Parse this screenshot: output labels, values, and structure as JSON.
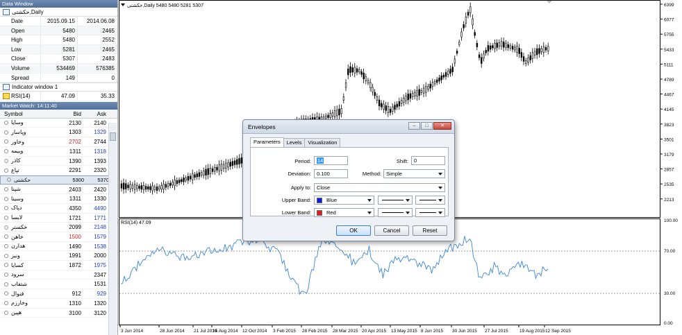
{
  "data_window": {
    "title": "Data Window",
    "symbol_row": "حکشتی,Daily",
    "rows": [
      {
        "label": "Date",
        "v1": "2015.09.15",
        "v2": "2014.06.08"
      },
      {
        "label": "Open",
        "v1": "5480",
        "v2": "2465"
      },
      {
        "label": "High",
        "v1": "5480",
        "v2": "2552"
      },
      {
        "label": "Low",
        "v1": "5281",
        "v2": "2465"
      },
      {
        "label": "Close",
        "v1": "5307",
        "v2": "2483"
      },
      {
        "label": "Volume",
        "v1": "534469",
        "v2": "576385"
      },
      {
        "label": "Spread",
        "v1": "149",
        "v2": "0"
      }
    ],
    "indicator_window": "Indicator window 1",
    "rsi_row": {
      "label": "RSI(14)",
      "v1": "47.09",
      "v2": "35.33"
    }
  },
  "market_watch": {
    "title": "Market Watch: 14:11:40",
    "headers": {
      "symbol": "Symbol",
      "bid": "Bid",
      "ask": "Ask"
    },
    "rows": [
      {
        "symbol": "وسایا",
        "bid": "2130",
        "ask": "2140",
        "bid_color": "#000",
        "ask_color": "#000"
      },
      {
        "symbol": "وپاسار",
        "bid": "1303",
        "ask": "1329",
        "bid_color": "#000",
        "ask_color": "#1f3fd1"
      },
      {
        "symbol": "وخاور",
        "bid": "2702",
        "ask": "2744",
        "bid_color": "#d62020",
        "ask_color": "#000"
      },
      {
        "symbol": "وبیمه",
        "bid": "1311",
        "ask": "1318",
        "bid_color": "#000",
        "ask_color": "#1f3fd1"
      },
      {
        "symbol": "کاذر",
        "bid": "1390",
        "ask": "1393",
        "bid_color": "#000",
        "ask_color": "#000"
      },
      {
        "symbol": "تپاع",
        "bid": "2291",
        "ask": "2320",
        "bid_color": "#000",
        "ask_color": "#000"
      },
      {
        "symbol": "حکشتی",
        "bid": "5300",
        "ask": "5370",
        "bid_color": "#000",
        "ask_color": "#000"
      },
      {
        "symbol": "کچاد",
        "bid": "2483",
        "ask": "2434",
        "bid_color": "#000",
        "ask_color": "#000"
      },
      {
        "symbol": "شپنا",
        "bid": "2403",
        "ask": "2420",
        "bid_color": "#000",
        "ask_color": "#000"
      },
      {
        "symbol": "وسینا",
        "bid": "1311",
        "ask": "1330",
        "bid_color": "#000",
        "ask_color": "#000"
      },
      {
        "symbol": "دپاک",
        "bid": "4350",
        "ask": "4490",
        "bid_color": "#000",
        "ask_color": "#1f3fd1"
      },
      {
        "symbol": "لابسا",
        "bid": "1721",
        "ask": "1771",
        "bid_color": "#000",
        "ask_color": "#1f3fd1"
      },
      {
        "symbol": "خکستر",
        "bid": "2099",
        "ask": "2148",
        "bid_color": "#000",
        "ask_color": "#1f3fd1"
      },
      {
        "symbol": "خاهن",
        "bid": "1500",
        "ask": "1579",
        "bid_color": "#d62020",
        "ask_color": "#1f3fd1"
      },
      {
        "symbol": "هدارن",
        "bid": "1490",
        "ask": "1538",
        "bid_color": "#000",
        "ask_color": "#1f3fd1"
      },
      {
        "symbol": "ونیز",
        "bid": "1991",
        "ask": "2000",
        "bid_color": "#000",
        "ask_color": "#000"
      },
      {
        "symbol": "کسایا",
        "bid": "1872",
        "ask": "1975",
        "bid_color": "#000",
        "ask_color": "#1f3fd1"
      },
      {
        "symbol": "سرود",
        "bid": "",
        "ask": "2347",
        "bid_color": "#000",
        "ask_color": "#000"
      },
      {
        "symbol": "شتفاب",
        "bid": "",
        "ask": "1531",
        "bid_color": "#000",
        "ask_color": "#000"
      },
      {
        "symbol": "فنوال",
        "bid": "912",
        "ask": "929",
        "bid_color": "#000",
        "ask_color": "#1f3fd1"
      },
      {
        "symbol": "وخارزم",
        "bid": "1310",
        "ask": "1320",
        "bid_color": "#000",
        "ask_color": "#000"
      },
      {
        "symbol": "هپین",
        "bid": "3100",
        "ask": "3120",
        "bid_color": "#000",
        "ask_color": "#000"
      }
    ]
  },
  "chart": {
    "header": "حکشتی,Daily  5480 5480 5281 5307",
    "rsi_label": "RSI(14) 47.09",
    "price_axis": [
      "6399",
      "6077",
      "5755",
      "5433",
      "5111",
      "4789",
      "4467",
      "4145",
      "3823",
      "3501",
      "3179",
      "2857",
      "2535",
      "2213"
    ],
    "rsi_axis": [
      "100.00",
      "70.00",
      "30.00",
      "0.00"
    ],
    "date_axis": [
      "3 Jun 2014",
      "28 Jun 2014",
      "21 Jul 2014",
      "25 Aug 2014",
      "12 Oct 2014",
      "3 Feb 2015",
      "28 Feb 2015",
      "28 Mar 2015",
      "20 Apr 2015",
      "13 May 2015",
      "8 Jun 2015",
      "30 Jun 2015",
      "27 Jul 2015",
      "19 Aug 2015",
      "12 Sep 2015"
    ],
    "rsi_color": "#3a86d8"
  },
  "dialog": {
    "title": "Envelopes",
    "tabs": [
      "Parameters",
      "Levels",
      "Visualization"
    ],
    "period_label": "Period:",
    "period_value": "14",
    "shift_label": "Shift:",
    "shift_value": "0",
    "deviation_label": "Deviation:",
    "deviation_value": "0.100",
    "method_label": "Method:",
    "method_value": "Simple",
    "apply_label": "Apply to:",
    "apply_value": "Close",
    "upper_label": "Upper Band:",
    "upper_color_name": "Blue",
    "upper_color": "#0b1fe0",
    "lower_label": "Lower Band:",
    "lower_color_name": "Red",
    "lower_color": "#e11b1b",
    "ok": "OK",
    "cancel": "Cancel",
    "reset": "Reset"
  }
}
